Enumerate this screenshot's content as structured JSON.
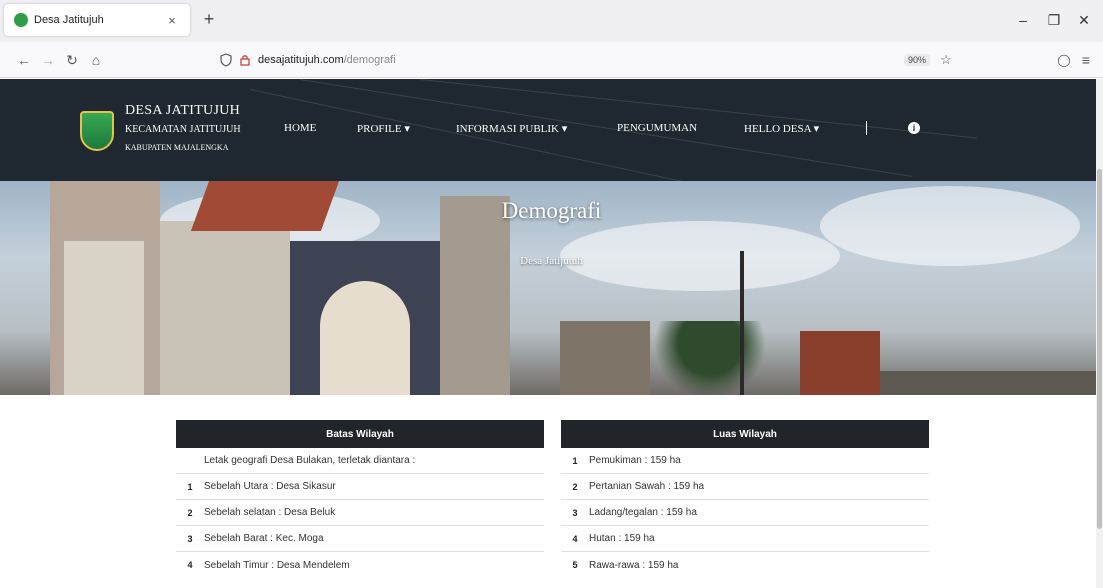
{
  "browser": {
    "tab_title": "Desa Jatitujuh",
    "tab_close": "×",
    "new_tab": "+",
    "url_host": "desajatitujuh.com",
    "url_path": "/demografi",
    "zoom": "90%",
    "icons": [
      "back-icon",
      "forward-icon",
      "reload-icon",
      "home-icon",
      "shield-icon",
      "lock-icon",
      "star-icon",
      "pocket-icon",
      "menu-icon"
    ]
  },
  "site": {
    "brand_title": "DESA JATITUJUH",
    "brand_subtitle": "KECAMATAN JATITUJUH",
    "brand_region": "KABUPATEN MAJALENGKA",
    "menu": [
      "HOME",
      "PROFILE ▾",
      "INFORMASI PUBLIK ▾",
      "PENGUMUMAN",
      "HELLO DESA ▾"
    ],
    "info_icon": "i"
  },
  "hero": {
    "title": "Demografi",
    "subtitle": "Desa Jatijutuh"
  },
  "batas": {
    "header": "Batas Wilayah",
    "intro": "Letak geografi Desa Bulakan, terletak diantara :",
    "rows": [
      {
        "no": "1",
        "text": "Sebelah Utara : Desa Sikasur"
      },
      {
        "no": "2",
        "text": "Sebelah selatan : Desa Beluk"
      },
      {
        "no": "3",
        "text": "Sebelah Barat : Kec. Moga"
      },
      {
        "no": "4",
        "text": "Sebelah Timur : Desa Mendelem"
      }
    ]
  },
  "luas": {
    "header": "Luas Wilayah",
    "rows": [
      {
        "no": "1",
        "text": "Pemukiman : 159 ha"
      },
      {
        "no": "2",
        "text": "Pertanian Sawah : 159 ha"
      },
      {
        "no": "3",
        "text": "Ladang/tegalan : 159 ha"
      },
      {
        "no": "4",
        "text": "Hutan : 159 ha"
      },
      {
        "no": "5",
        "text": "Rawa-rawa : 159 ha"
      }
    ]
  }
}
